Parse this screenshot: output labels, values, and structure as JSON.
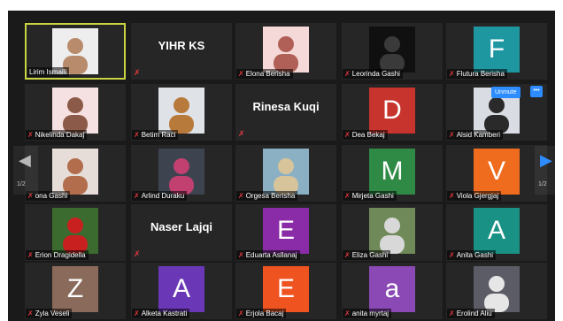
{
  "tiles": [
    {
      "name": "Lirim Ismaili",
      "kind": "photo",
      "bg": "#eeeeee",
      "fg": "#b78b6c",
      "active": true
    },
    {
      "kind": "nametile",
      "big": "YIHR KS"
    },
    {
      "name": "Elona Berisha",
      "kind": "photo",
      "bg": "#f4d9d8",
      "fg": "#b06056"
    },
    {
      "name": "Leorinda Gashi",
      "kind": "photo",
      "bg": "#101010",
      "fg": "#3a3a3a"
    },
    {
      "name": "Flutura Berisha",
      "kind": "letter",
      "letter": "F",
      "color": "#1e97a0"
    },
    {
      "name": "Nikelinda Dakaj",
      "kind": "photo",
      "bg": "#f5e1e1",
      "fg": "#8b5a48"
    },
    {
      "name": "Betim Raci",
      "kind": "photo",
      "bg": "#dfe2e6",
      "fg": "#b77a3a"
    },
    {
      "kind": "nametile",
      "big": "Rinesa Kuqi"
    },
    {
      "name": "Dea Bekaj",
      "kind": "letter",
      "letter": "D",
      "color": "#c7342d"
    },
    {
      "name": "Alsid Kamberi",
      "kind": "photo",
      "bg": "#d9dde3",
      "fg": "#2a2a2a"
    },
    {
      "name": "ona Gashi",
      "kind": "photo",
      "bg": "#e6ddd8",
      "fg": "#b26d4d"
    },
    {
      "name": "Arlind Duraku",
      "kind": "photo",
      "bg": "#3d4450",
      "fg": "#c24070"
    },
    {
      "name": "Orgesa Berisha",
      "kind": "photo",
      "bg": "#8bb0c4",
      "fg": "#d7c49a"
    },
    {
      "name": "Mirjeta Gashi",
      "kind": "letter",
      "letter": "M",
      "color": "#2f8a45"
    },
    {
      "name": "Viola Gjergjaj",
      "kind": "letter",
      "letter": "V",
      "color": "#ef6c1f"
    },
    {
      "name": "Erion Dragidella",
      "kind": "photo",
      "bg": "#3c6b2f",
      "fg": "#c8201f"
    },
    {
      "kind": "nametile",
      "big": "Naser Lajqi"
    },
    {
      "name": "Eduarta Asllanaj",
      "kind": "letter",
      "letter": "E",
      "color": "#8a2ca7"
    },
    {
      "name": "Eliza Gashi",
      "kind": "photo",
      "bg": "#6f8a58",
      "fg": "#d8d8d8"
    },
    {
      "name": "Anita Gashi",
      "kind": "letter",
      "letter": "A",
      "color": "#1a9185"
    },
    {
      "name": "Zyla Veseli",
      "kind": "letter",
      "letter": "Z",
      "color": "#8a6a5a"
    },
    {
      "name": "Alketa Kastrati",
      "kind": "letter",
      "letter": "A",
      "color": "#6a38b6"
    },
    {
      "name": "Erjola Bacaj",
      "kind": "letter",
      "letter": "E",
      "color": "#ef5320"
    },
    {
      "name": "anita myrtaj",
      "kind": "letter",
      "letter": "a",
      "color": "#8a49b5"
    },
    {
      "name": "Erolind Aliu",
      "kind": "photo",
      "bg": "#5c5c66",
      "fg": "#e6e6e6"
    }
  ],
  "icons": {
    "mic_muted": "✗"
  },
  "nav": {
    "page_left": "1/2",
    "page_right": "1/2",
    "prev_arrow": "◀",
    "next_arrow": "▶",
    "prev_color": "#b8b8b8",
    "next_color": "#2d8cff"
  },
  "hover": {
    "unmute_label": "Unmute",
    "more_label": "•••"
  },
  "colors": {
    "stage": "#1a1a1a",
    "tile": "#262626",
    "active_border": "#c9d442",
    "mic": "#e0383e",
    "accent": "#2d8cff"
  }
}
